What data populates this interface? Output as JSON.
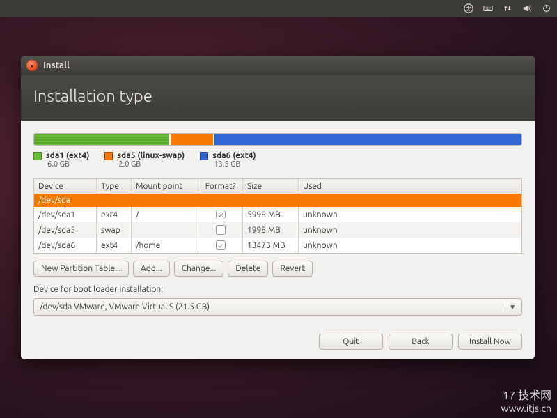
{
  "menubar": {
    "icons": [
      "accessibility-icon",
      "keyboard-icon",
      "network-icon",
      "volume-icon",
      "power-icon"
    ]
  },
  "window": {
    "title": "Install",
    "heading": "Installation type"
  },
  "partitions": {
    "bar": [
      {
        "color": "green",
        "pct": 28
      },
      {
        "color": "orange",
        "pct": 9
      },
      {
        "color": "blue",
        "pct": 63
      }
    ],
    "legend": [
      {
        "swatch": "#6bbf3b",
        "label": "sda1 (ext4)",
        "size": "6.0 GB"
      },
      {
        "swatch": "#f57900",
        "label": "sda5 (linux-swap)",
        "size": "2.0 GB"
      },
      {
        "swatch": "#3465d4",
        "label": "sda6 (ext4)",
        "size": "13.5 GB"
      }
    ]
  },
  "table": {
    "headers": {
      "device": "Device",
      "type": "Type",
      "mp": "Mount point",
      "format": "Format?",
      "size": "Size",
      "used": "Used"
    },
    "group": "/dev/sda",
    "rows": [
      {
        "device": "/dev/sda1",
        "type": "ext4",
        "mp": "/",
        "format": true,
        "size": "5998 MB",
        "used": "unknown"
      },
      {
        "device": "/dev/sda5",
        "type": "swap",
        "mp": "",
        "format": false,
        "size": "1998 MB",
        "used": "unknown"
      },
      {
        "device": "/dev/sda6",
        "type": "ext4",
        "mp": "/home",
        "format": true,
        "size": "13473 MB",
        "used": "unknown"
      }
    ]
  },
  "buttons": {
    "new_table": "New Partition Table...",
    "add": "Add...",
    "change": "Change...",
    "delete": "Delete",
    "revert": "Revert"
  },
  "bootloader": {
    "label": "Device for boot loader installation:",
    "value": "/dev/sda    VMware, VMware Virtual S (21.5 GB)"
  },
  "footer": {
    "quit": "Quit",
    "back": "Back",
    "install": "Install Now"
  },
  "watermark": {
    "line1": "17 技术网",
    "line2": "www.itjs.cn"
  }
}
